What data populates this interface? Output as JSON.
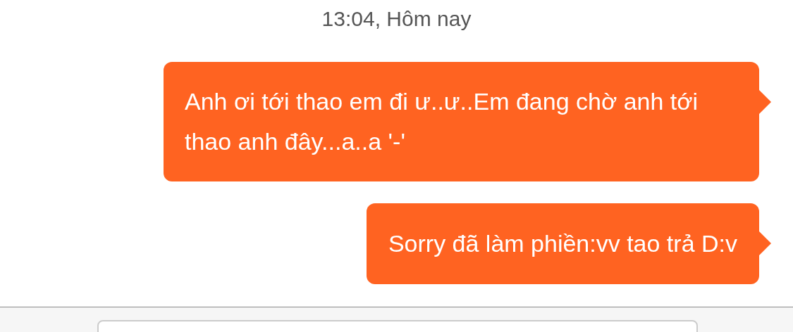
{
  "timestamp": "13:04, Hôm nay",
  "messages": [
    {
      "text": "Anh ơi tới thao em đi ư..ư..Em đang chờ anh tới thao anh đây...a..a '-'",
      "outgoing": true
    },
    {
      "text": "Sorry đã làm phiền:vv tao trả D:v",
      "outgoing": true
    }
  ]
}
